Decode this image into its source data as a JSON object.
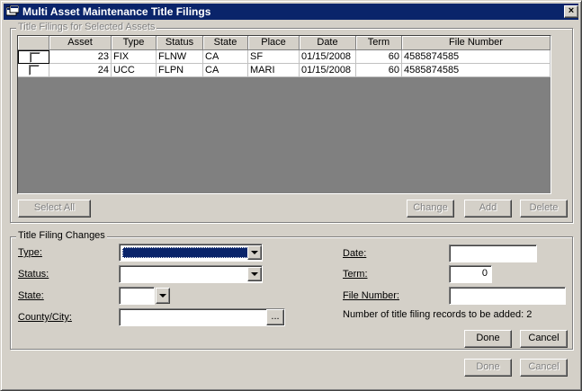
{
  "window": {
    "title": "Multi Asset Maintenance Title Filings",
    "close_glyph": "×"
  },
  "selected_group": {
    "label": "Title Filings for Selected Assets",
    "columns": [
      "",
      "Asset",
      "Type",
      "Status",
      "State",
      "Place",
      "Date",
      "Term",
      "File Number"
    ],
    "rows": [
      {
        "checked": false,
        "asset": "23",
        "type": "FIX",
        "status": "FLNW",
        "state": "CA",
        "place": "SF",
        "date": "01/15/2008",
        "term": "60",
        "file_number": "4585874585"
      },
      {
        "checked": false,
        "asset": "24",
        "type": "UCC",
        "status": "FLPN",
        "state": "CA",
        "place": "MARI",
        "date": "01/15/2008",
        "term": "60",
        "file_number": "4585874585"
      }
    ],
    "buttons": {
      "select_all": "Select All",
      "change": "Change",
      "add": "Add",
      "delete": "Delete"
    }
  },
  "changes_group": {
    "label": "Title Filing Changes",
    "type_label": "Type:",
    "type_value": "",
    "status_label": "Status:",
    "status_value": "",
    "state_label": "State:",
    "state_value": "",
    "county_label": "County/City:",
    "county_value": "",
    "browse_label": "...",
    "date_label": "Date:",
    "date_value": "",
    "term_label": "Term:",
    "term_value": "0",
    "file_number_label": "File Number:",
    "file_number_value": "",
    "records_note": "Number of title filing records to be added: 2",
    "done": "Done",
    "cancel": "Cancel"
  },
  "footer": {
    "done": "Done",
    "cancel": "Cancel"
  },
  "icons": {
    "app": "window-app-icon",
    "close": "close-icon",
    "dropdown": "chevron-down-icon"
  }
}
